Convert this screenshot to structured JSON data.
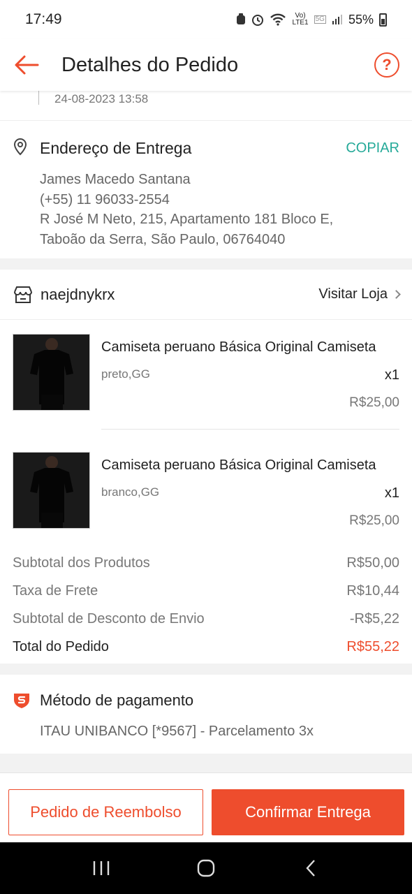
{
  "status_bar": {
    "time": "17:49",
    "network_top": "Vo)",
    "network_bottom": "LTE1",
    "network_5g": "5G",
    "battery": "55%"
  },
  "header": {
    "title": "Detalhes do Pedido"
  },
  "timeline": {
    "last_date": "24-08-2023 13:58"
  },
  "address": {
    "title": "Endereço de Entrega",
    "copy_label": "COPIAR",
    "name": "James Macedo Santana",
    "phone": "(+55) 11 96033-2554",
    "line1": "R José M Neto, 215, Apartamento 181 Bloco E,",
    "line2": "Taboão da Serra, São Paulo, 06764040"
  },
  "shop": {
    "name": "naejdnykrx",
    "visit_label": "Visitar Loja"
  },
  "products": [
    {
      "name": "Camiseta peruano Básica Original Camiseta",
      "variant": "preto,GG",
      "qty": "x1",
      "price": "R$25,00"
    },
    {
      "name": "Camiseta peruano Básica Original Camiseta",
      "variant": "branco,GG",
      "qty": "x1",
      "price": "R$25,00"
    }
  ],
  "summary": {
    "subtotal_label": "Subtotal dos Produtos",
    "subtotal_value": "R$50,00",
    "shipping_label": "Taxa de Frete",
    "shipping_value": "R$10,44",
    "discount_label": "Subtotal de Desconto de Envio",
    "discount_value": "-R$5,22",
    "total_label": "Total do Pedido",
    "total_value": "R$55,22"
  },
  "payment": {
    "title": "Método de pagamento",
    "value": "ITAU UNIBANCO [*9567] - Parcelamento 3x"
  },
  "actions": {
    "refund_label": "Pedido de Reembolso",
    "confirm_label": "Confirmar Entrega"
  },
  "colors": {
    "accent": "#ee4d2d",
    "copy": "#26aa99"
  },
  "icons": [
    "back-arrow-icon",
    "help-icon",
    "location-pin-icon",
    "store-icon",
    "chevron-right-icon",
    "payment-shield-icon",
    "recent-apps-icon",
    "home-icon",
    "back-icon"
  ]
}
